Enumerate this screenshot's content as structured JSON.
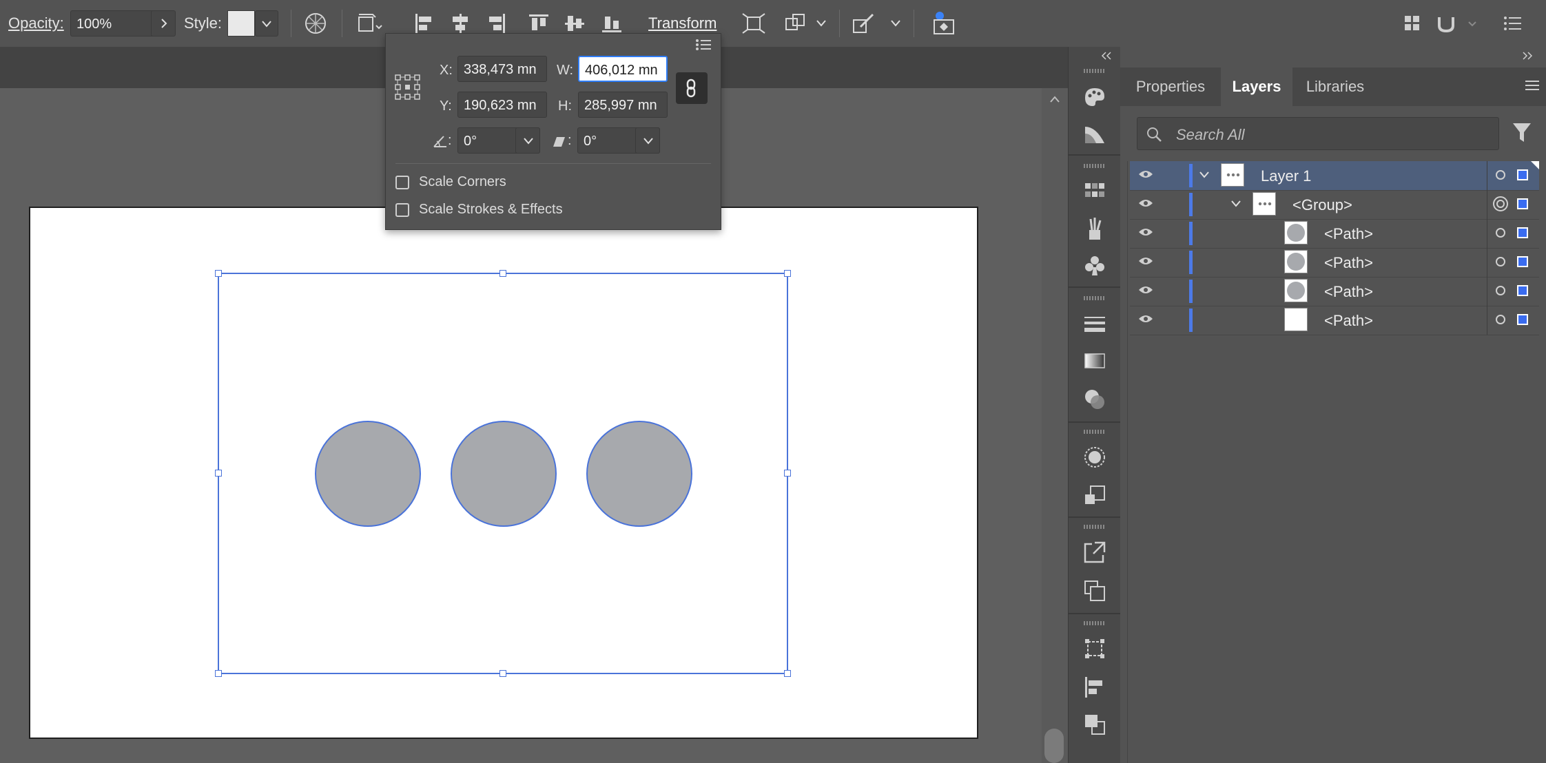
{
  "controlbar": {
    "opacity_label": "Opacity:",
    "opacity_value": "100%",
    "style_label": "Style:",
    "transform_label": "Transform"
  },
  "transform_popup": {
    "x_label": "X:",
    "x_value": "338,473 mn",
    "y_label": "Y:",
    "y_value": "190,623 mn",
    "w_label": "W:",
    "w_value": "406,012 mn",
    "h_label": "H:",
    "h_value": "285,997 mn",
    "angle_label": ":",
    "angle_value": "0°",
    "shear_label": ":",
    "shear_value": "0°",
    "scale_corners_label": "Scale Corners",
    "scale_strokes_label": "Scale Strokes & Effects"
  },
  "panels": {
    "tabs": [
      {
        "label": "Properties"
      },
      {
        "label": "Layers"
      },
      {
        "label": "Libraries"
      }
    ],
    "search_placeholder": "Search All",
    "layers": [
      {
        "name": "Layer 1"
      },
      {
        "name": "<Group>"
      },
      {
        "name": "<Path>"
      },
      {
        "name": "<Path>"
      },
      {
        "name": "<Path>"
      },
      {
        "name": "<Path>"
      }
    ]
  },
  "colors": {
    "selection_blue": "#4a73d9",
    "circle_fill": "#a7a9ad",
    "layer_color": "#4c7ae8"
  }
}
